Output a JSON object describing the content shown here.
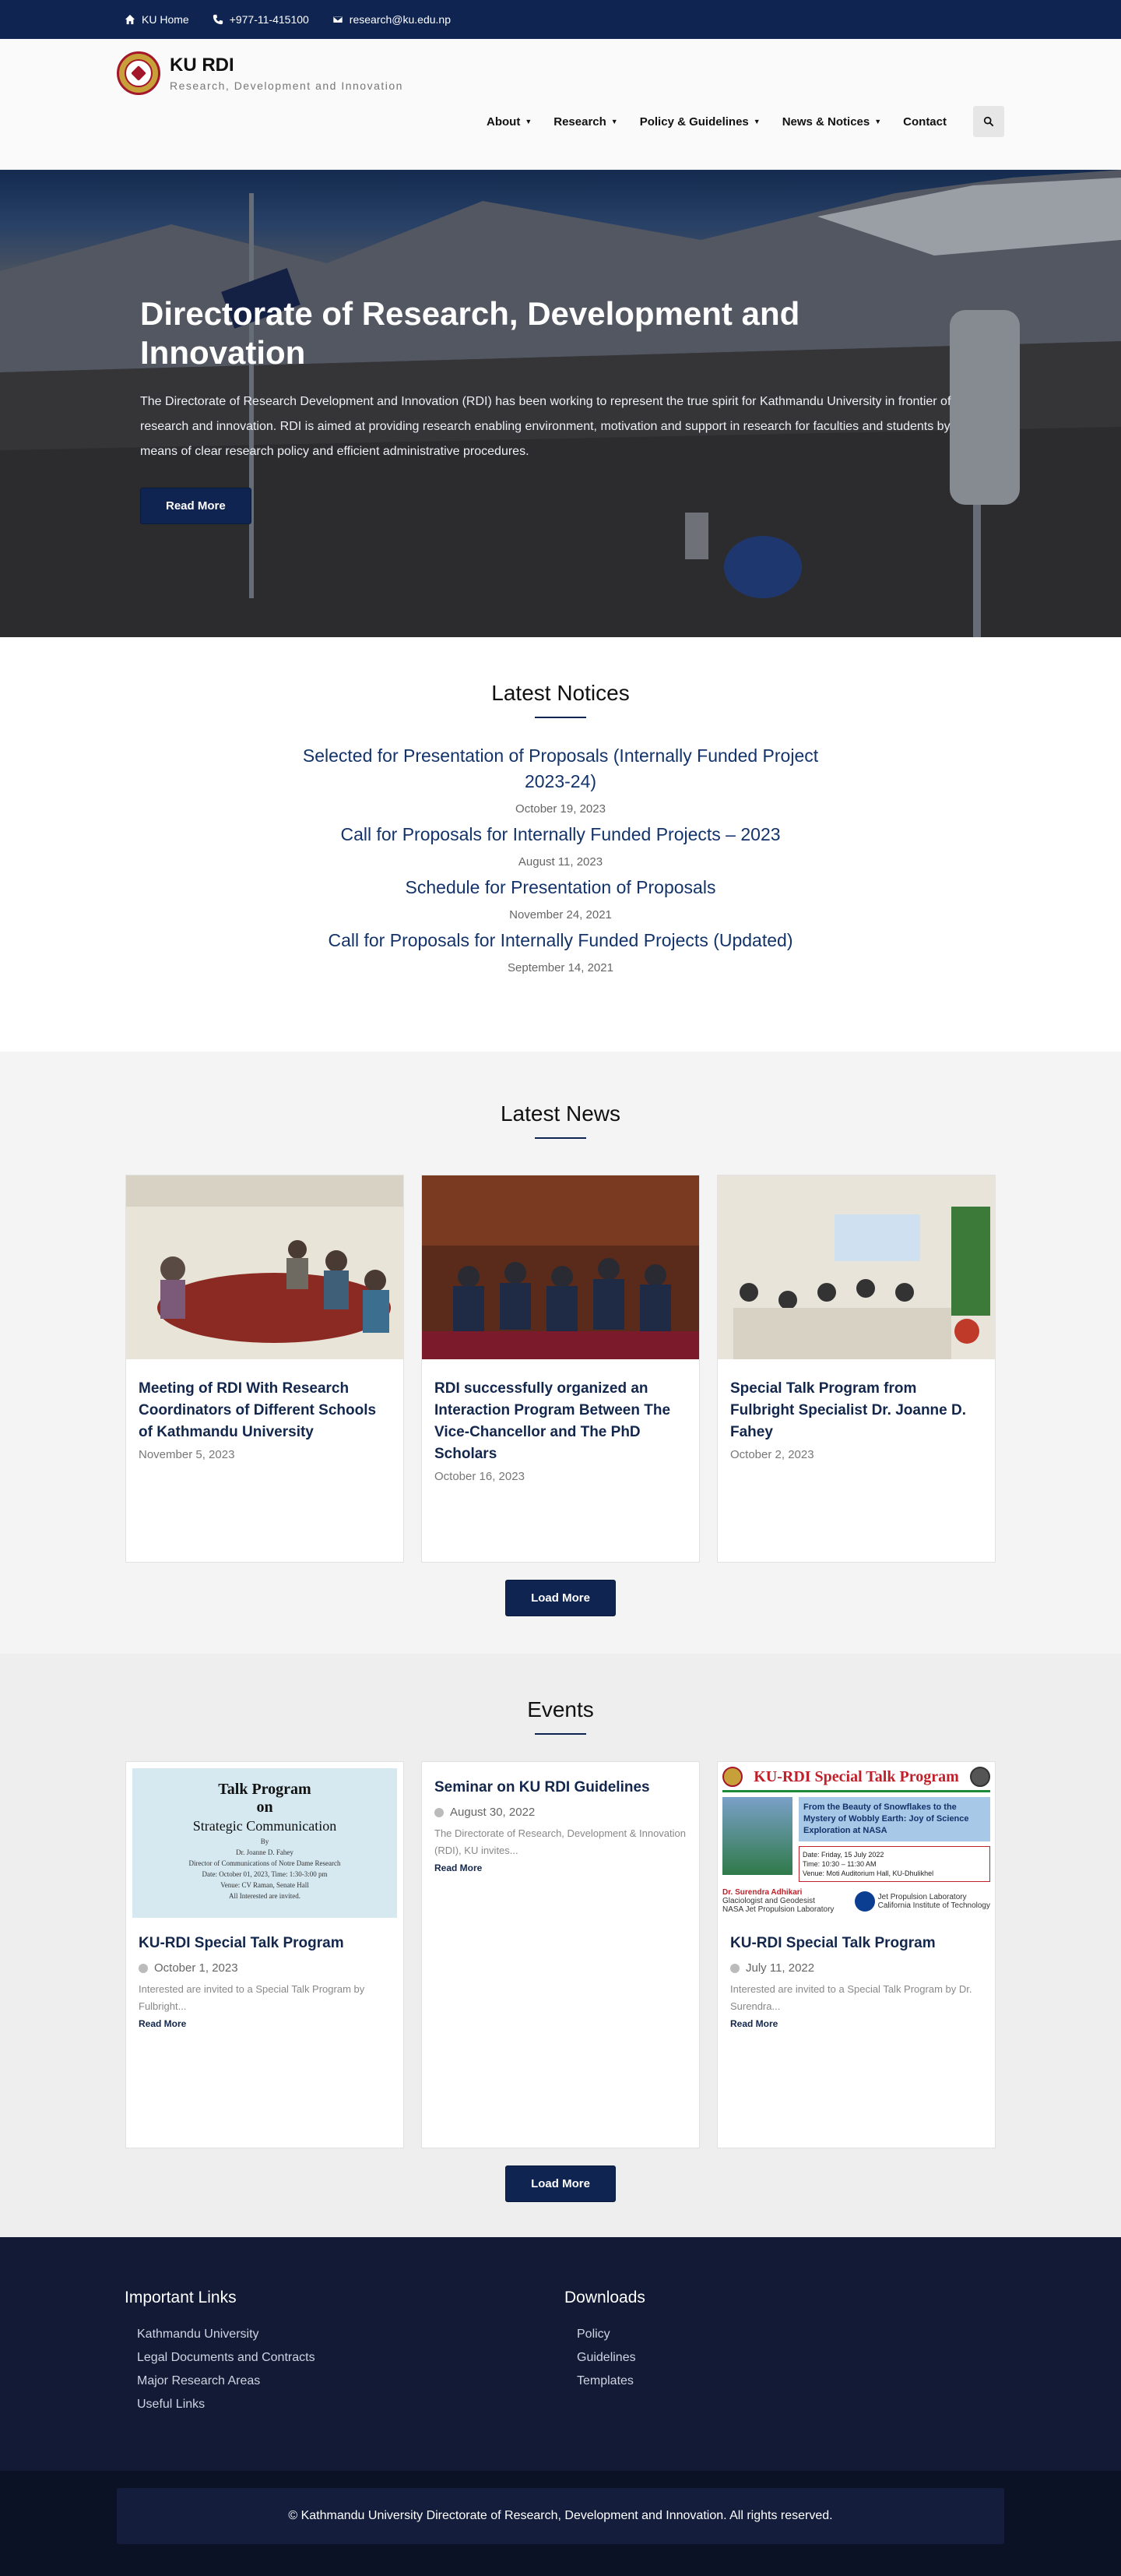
{
  "topbar": {
    "home": "KU Home",
    "phone": "+977-11-415100",
    "email": "research@ku.edu.np"
  },
  "brand": {
    "title": "KU RDI",
    "subtitle": "Research, Development and Innovation"
  },
  "nav": {
    "about": "About",
    "research": "Research",
    "policy": "Policy & Guidelines",
    "news": "News & Notices",
    "contact": "Contact"
  },
  "hero": {
    "title": "Directorate of Research, Development and Innovation",
    "text": "The Directorate of Research Development and Innovation (RDI) has been working to represent the true spirit for Kathmandu University in frontier of research and innovation. RDI is aimed at providing research enabling environment, motivation and support in research for faculties and students by means of clear research policy and efficient administrative procedures.",
    "button": "Read More"
  },
  "notices": {
    "title": "Latest Notices",
    "items": [
      {
        "title": "Selected for Presentation of Proposals (Internally Funded Project 2023-24)",
        "date": "October 19, 2023"
      },
      {
        "title": "Call for Proposals for Internally Funded Projects – 2023",
        "date": "August 11, 2023"
      },
      {
        "title": "Schedule for Presentation of Proposals",
        "date": "November 24, 2021"
      },
      {
        "title": "Call for Proposals for Internally Funded Projects (Updated)",
        "date": "September 14, 2021"
      }
    ]
  },
  "news": {
    "title": "Latest News",
    "items": [
      {
        "title": "Meeting of RDI With Research Coordinators of Different Schools of Kathmandu University",
        "date": "November 5, 2023"
      },
      {
        "title": "RDI successfully organized an Interaction Program Between The Vice-Chancellor and The PhD Scholars",
        "date": "October 16, 2023"
      },
      {
        "title": "Special Talk Program from Fulbright Specialist Dr. Joanne D. Fahey",
        "date": "October 2, 2023"
      }
    ],
    "load_more": "Load More"
  },
  "events": {
    "title": "Events",
    "items": [
      {
        "title": "KU-RDI Special Talk Program",
        "date": "October 1, 2023",
        "excerpt": "Interested are invited to a Special Talk Program by Fulbright...",
        "read_more": "Read More"
      },
      {
        "title": "Seminar on KU RDI Guidelines",
        "date": "August 30, 2022",
        "excerpt": "The Directorate of Research, Development & Innovation (RDI), KU invites...",
        "read_more": "Read More"
      },
      {
        "title": "KU-RDI Special Talk Program",
        "date": "July 11, 2022",
        "excerpt": "Interested are invited to a Special Talk Program by Dr. Surendra...",
        "read_more": "Read More"
      }
    ],
    "poster1": {
      "line1": "Talk Program",
      "line2": "on",
      "line3": "Strategic Communication",
      "by": "By",
      "speaker": "Dr. Joanne D. Fahey",
      "role": "Director of Communications of Notre Dame Research",
      "datetime": "Date: October 01, 2023,  Time: 1:30-3:00 pm",
      "venue": "Venue: CV Raman, Senate Hall",
      "invite": "All Interested are invited."
    },
    "poster2": {
      "title": "KU-RDI Special Talk Program",
      "topic": "From the Beauty of Snowflakes to the Mystery of Wobbly Earth: Joy of Science Exploration at NASA",
      "date": "Date: Friday, 15 July 2022",
      "time": "Time: 10:30 – 11:30 AM",
      "venue": "Venue: Moti Auditorium Hall, KU-Dhulikhel",
      "speaker": "Dr. Surendra Adhikari",
      "role1": "Glaciologist and Geodesist",
      "role2": "NASA Jet Propulsion Laboratory",
      "lab": "Jet Propulsion Laboratory",
      "lab_sub": "California Institute of Technology"
    },
    "load_more": "Load More"
  },
  "footer": {
    "links_title": "Important Links",
    "links": [
      "Kathmandu University",
      "Legal Documents and Contracts",
      "Major Research Areas",
      "Useful Links"
    ],
    "downloads_title": "Downloads",
    "downloads": [
      "Policy",
      "Guidelines",
      "Templates"
    ],
    "copyright": "© Kathmandu University Directorate of Research, Development and Innovation. All rights reserved."
  }
}
